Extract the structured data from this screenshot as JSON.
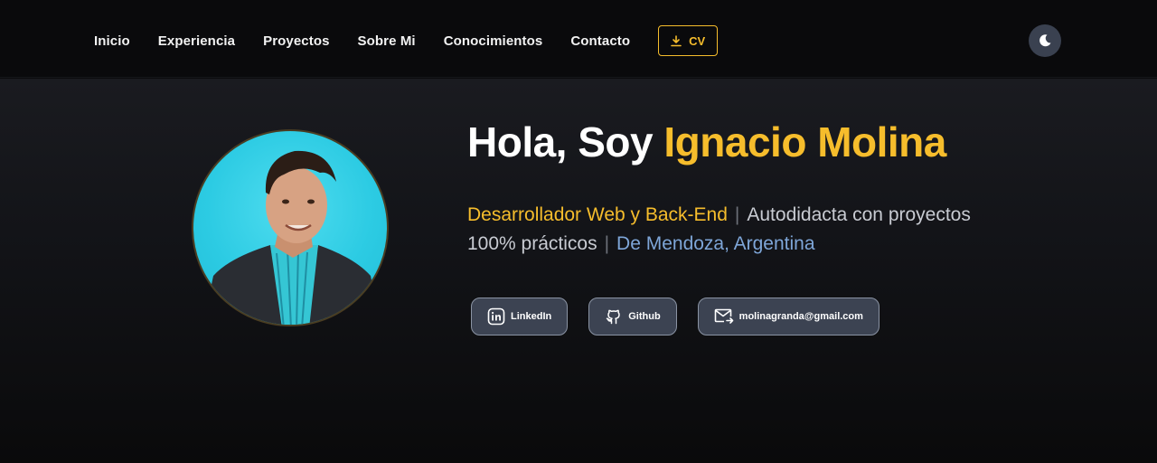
{
  "nav": {
    "links": [
      "Inicio",
      "Experiencia",
      "Proyectos",
      "Sobre Mi",
      "Conocimientos",
      "Contacto"
    ],
    "cv_label": "CV",
    "theme_icon": "moon-icon"
  },
  "hero": {
    "greeting": "Hola, Soy ",
    "name": "Ignacio Molina",
    "role": "Desarrollador Web y Back-End",
    "separator": "|",
    "description": "Autodidacta con proyectos 100% prácticos",
    "location": "De Mendoza, Argentina"
  },
  "social": {
    "linkedin": "LinkedIn",
    "github": "Github",
    "email": "molinagranda@gmail.com"
  },
  "colors": {
    "accent": "#f6bd2c",
    "location": "#7ea6d8",
    "avatar_bg": "#2ccbe3",
    "button_bg": "#3c4352"
  }
}
